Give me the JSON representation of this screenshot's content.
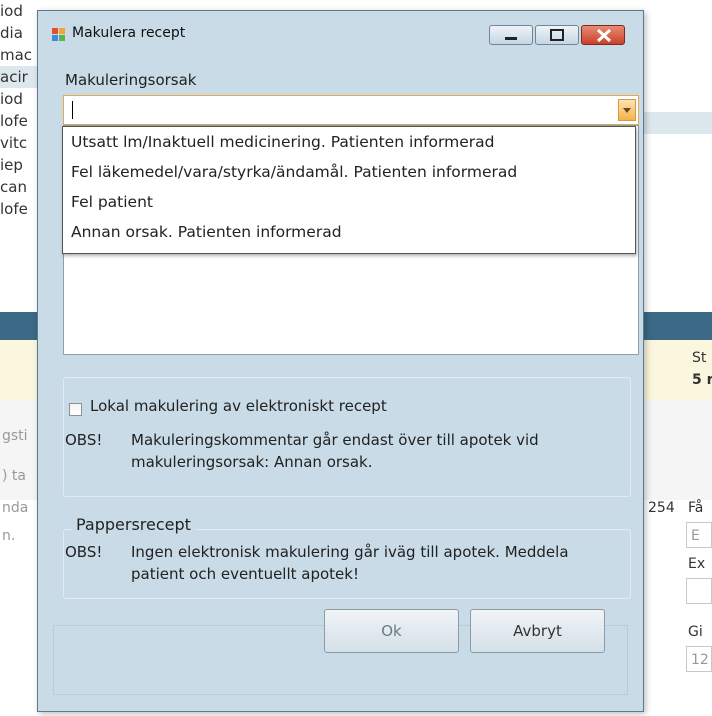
{
  "background": {
    "list_items": [
      "iod",
      "dia",
      "mac",
      "acir",
      "iod",
      "lofe",
      "vitc",
      "iep",
      "can",
      "lofe"
    ],
    "right_col": {
      "st_label": "St",
      "five_label": "5 r",
      "num_254": "254",
      "fa_label": "Få",
      "e_field": "E",
      "ex_label": "Ex",
      "gi_label": "Gi",
      "gi_value": "12"
    },
    "left_col": {
      "gst": "gsti",
      "ta": ") ta",
      "nda": "nda",
      "n": "n."
    }
  },
  "dialog": {
    "title": "Makulera recept",
    "reason_label": "Makuleringsorsak",
    "reason_value": "",
    "dropdown_options": [
      "Utsatt lm/Inaktuell medicinering. Patienten informerad",
      "Fel läkemedel/vara/styrka/ändamål. Patienten informerad",
      "Fel patient",
      "Annan orsak. Patienten informerad"
    ],
    "local_checkbox_label": "Lokal makulering av elektroniskt recept",
    "local_checkbox_checked": false,
    "obs1_tag": "OBS!",
    "obs1_text_line1": "Makuleringskommentar går endast över till apotek vid",
    "obs1_text_line2": "makuleringsorsak: Annan orsak.",
    "paper_group_label": "Pappersrecept",
    "obs2_tag": "OBS!",
    "obs2_text_line1": "Ingen elektronisk makulering går iväg till apotek. Meddela",
    "obs2_text_line2": "patient och eventuellt apotek!",
    "ok_label": "Ok",
    "cancel_label": "Avbryt"
  },
  "colors": {
    "dialog_bg": "#c9dbe6",
    "combo_border": "#e8a94a",
    "close_button": "#c9412a",
    "app_bar": "#3b6a86",
    "highlight_strip": "#fbf6de"
  },
  "icons": [
    "app-icon",
    "minimize-icon",
    "maximize-icon",
    "close-icon",
    "dropdown-arrow-icon"
  ]
}
